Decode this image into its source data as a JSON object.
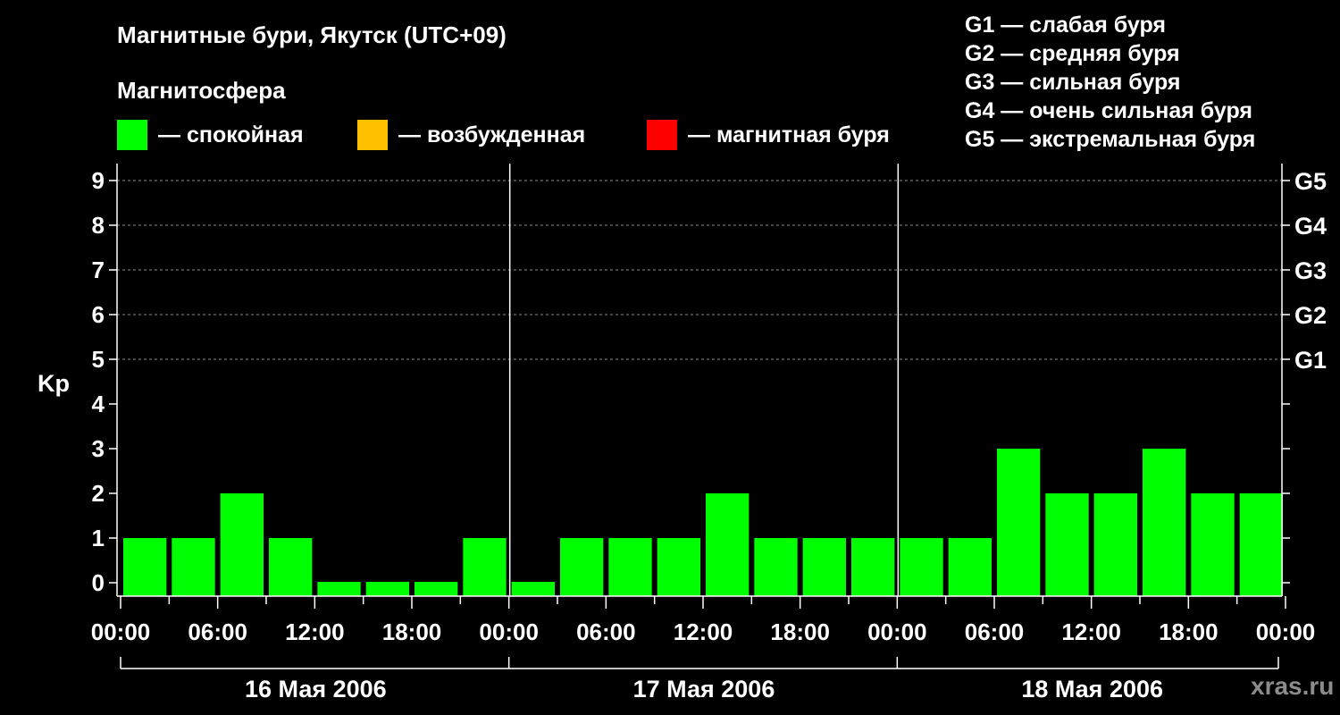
{
  "chart_data": {
    "type": "bar",
    "title": "Магнитные бури, Якутск (UTC+09)",
    "subtitle": "Магнитосфера",
    "ylabel": "Kp",
    "ylim": [
      0,
      9
    ],
    "yticks": [
      "0",
      "1",
      "2",
      "3",
      "4",
      "5",
      "6",
      "7",
      "8",
      "9"
    ],
    "right_axis_labels": [
      {
        "kp": 5,
        "label": "G1"
      },
      {
        "kp": 6,
        "label": "G2"
      },
      {
        "kp": 7,
        "label": "G3"
      },
      {
        "kp": 8,
        "label": "G4"
      },
      {
        "kp": 9,
        "label": "G5"
      }
    ],
    "xticks": [
      "00:00",
      "06:00",
      "12:00",
      "18:00",
      "00:00",
      "06:00",
      "12:00",
      "18:00",
      "00:00",
      "06:00",
      "12:00",
      "18:00",
      "00:00"
    ],
    "days": [
      "16 Мая 2006",
      "17 Мая 2006",
      "18 Мая 2006"
    ],
    "interval_hours": 3,
    "values": [
      1,
      1,
      2,
      1,
      0,
      0,
      0,
      1,
      0,
      1,
      1,
      1,
      2,
      1,
      1,
      1,
      1,
      1,
      3,
      2,
      2,
      3,
      2,
      2
    ],
    "gridlines": "dashed at Kp 5–9",
    "colors": {
      "calm": "#00ff00",
      "excited": "#ffc000",
      "storm": "#ff0000"
    }
  },
  "legend": {
    "calm": "— спокойная",
    "excited": "— возбужденная",
    "storm": "— магнитная буря"
  },
  "g_legend": [
    "G1 — слабая буря",
    "G2 — средняя буря",
    "G3 — сильная буря",
    "G4 — очень сильная буря",
    "G5 — экстремальная буря"
  ],
  "watermark": "xras.ru"
}
